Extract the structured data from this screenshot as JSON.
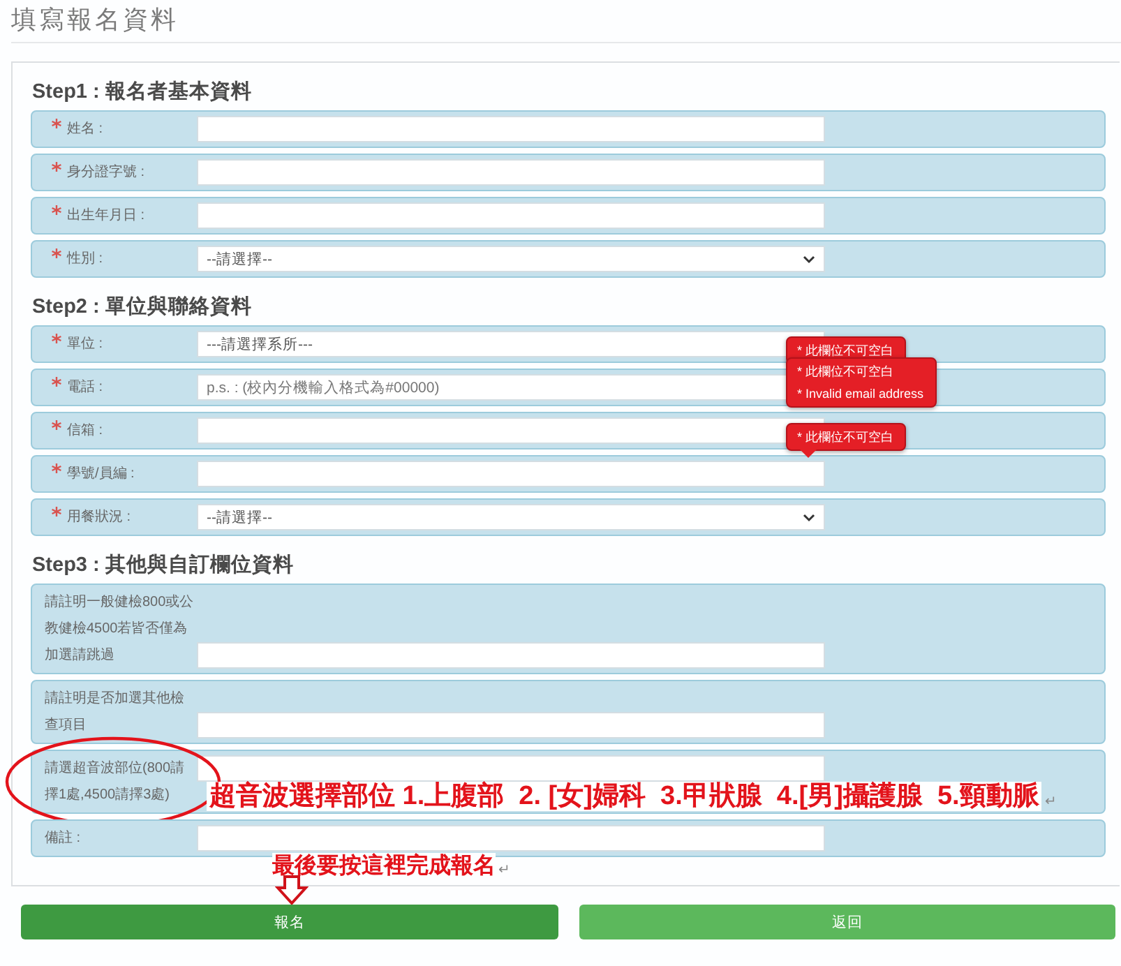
{
  "page_title": "填寫報名資料",
  "sections": [
    {
      "heading": "Step1 : 報名者基本資料",
      "fields": [
        {
          "label": "姓名 :",
          "required": true,
          "kind": "text"
        },
        {
          "label": "身分證字號 :",
          "required": true,
          "kind": "text"
        },
        {
          "label": "出生年月日 :",
          "required": true,
          "kind": "text"
        },
        {
          "label": "性別 :",
          "required": true,
          "kind": "select",
          "value": "--請選擇--"
        }
      ]
    },
    {
      "heading": "Step2 : 單位與聯絡資料",
      "fields": [
        {
          "label": "單位 :",
          "required": true,
          "kind": "select",
          "value": "---請選擇系所---"
        },
        {
          "label": "電話 :",
          "required": true,
          "kind": "text",
          "placeholder": "p.s. : (校內分機輸入格式為#00000)",
          "errors": [
            "* 此欄位不可空白"
          ]
        },
        {
          "label": "信箱 :",
          "required": true,
          "kind": "text",
          "errors": [
            "* 此欄位不可空白",
            "* Invalid email address"
          ]
        },
        {
          "label": "學號/員編 :",
          "required": true,
          "kind": "text",
          "errors": [
            "* 此欄位不可空白"
          ]
        },
        {
          "label": "用餐狀況 :",
          "required": true,
          "kind": "select",
          "value": "--請選擇--"
        }
      ]
    },
    {
      "heading": "Step3 : 其他與自訂欄位資料",
      "fields": [
        {
          "label": "請註明一般健檢800或公教健檢4500若皆否僅為加選請跳過",
          "required": false,
          "kind": "text"
        },
        {
          "label": "請註明是否加選其他檢查項目",
          "required": false,
          "kind": "text"
        },
        {
          "label": "請選超音波部位(800請擇1處,4500請擇3處)",
          "required": false,
          "kind": "text",
          "note": {
            "text": "超音波選擇部位 1.上腹部  2. [女]婦科  3.甲狀腺  4.[男]攝護腺  5.頸動脈",
            "mark": "↵"
          }
        },
        {
          "label": "備註 :",
          "required": false,
          "kind": "text"
        }
      ]
    }
  ],
  "submit_note": {
    "text": "最後要按這裡完成報名",
    "mark": "↵"
  },
  "buttons": [
    {
      "label": "報名",
      "kind": "primary"
    },
    {
      "label": "返回",
      "kind": "secondary"
    }
  ]
}
